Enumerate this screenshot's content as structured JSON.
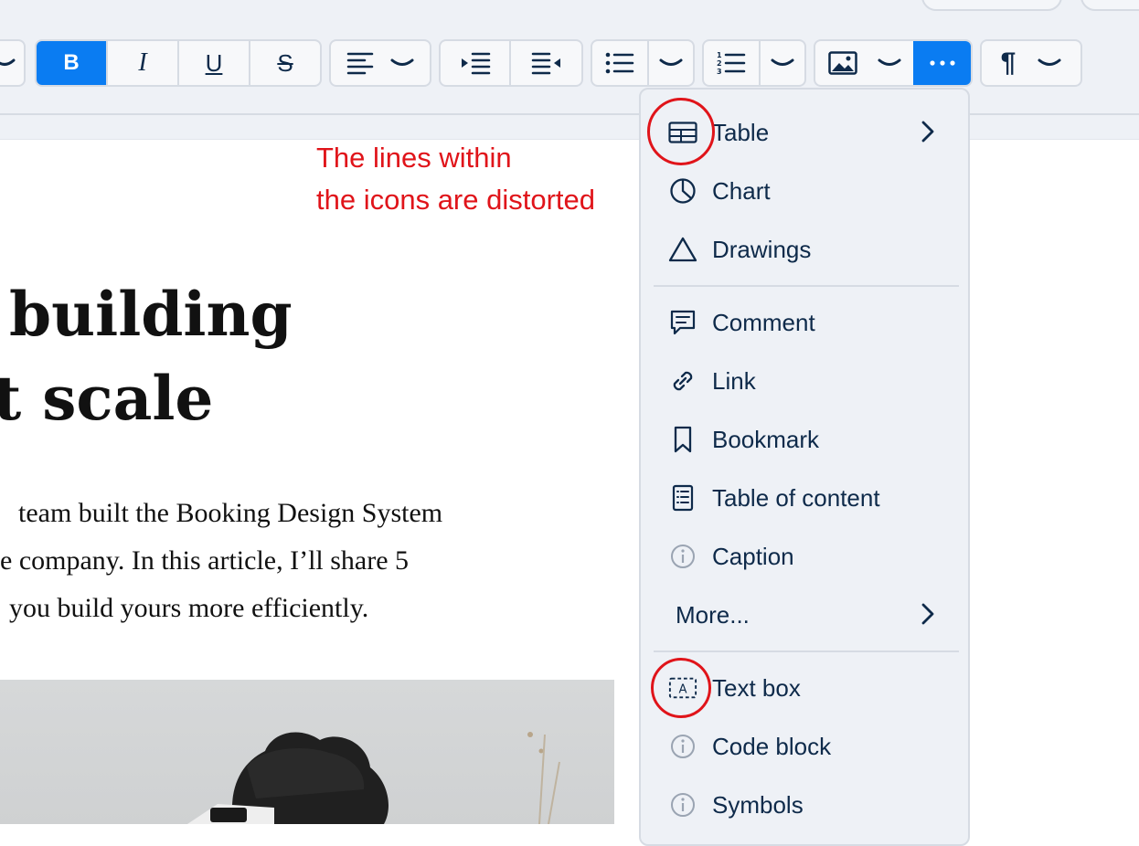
{
  "toolbar": {
    "bold_label": "B",
    "italic_label": "I",
    "underline_label": "U",
    "strike_label": "S",
    "paragraph_label": "¶",
    "accent_color": "#0a7cf2"
  },
  "annotation": {
    "line1": "The lines within",
    "line2": "the icons are distorted",
    "color": "#e0141a"
  },
  "document": {
    "title_line1": "building",
    "title_line2": "at scale",
    "body_line1": "team built the Booking Design System",
    "body_line2": "e company. In this article, I’ll share 5",
    "body_line3": "you build yours more efficiently."
  },
  "insert_menu": {
    "items": [
      {
        "label": "Table",
        "icon": "table-icon",
        "submenu": true
      },
      {
        "label": "Chart",
        "icon": "chart-icon"
      },
      {
        "label": "Drawings",
        "icon": "drawings-icon"
      },
      {
        "label": "Comment",
        "icon": "comment-icon"
      },
      {
        "label": "Link",
        "icon": "link-icon"
      },
      {
        "label": "Bookmark",
        "icon": "bookmark-icon"
      },
      {
        "label": "Table of content",
        "icon": "table-of-content-icon"
      },
      {
        "label": "Caption",
        "icon": "info-icon"
      },
      {
        "label": "More...",
        "submenu": true
      },
      {
        "label": "Text box",
        "icon": "text-box-icon"
      },
      {
        "label": "Code block",
        "icon": "info-icon"
      },
      {
        "label": "Symbols",
        "icon": "info-icon"
      }
    ]
  }
}
